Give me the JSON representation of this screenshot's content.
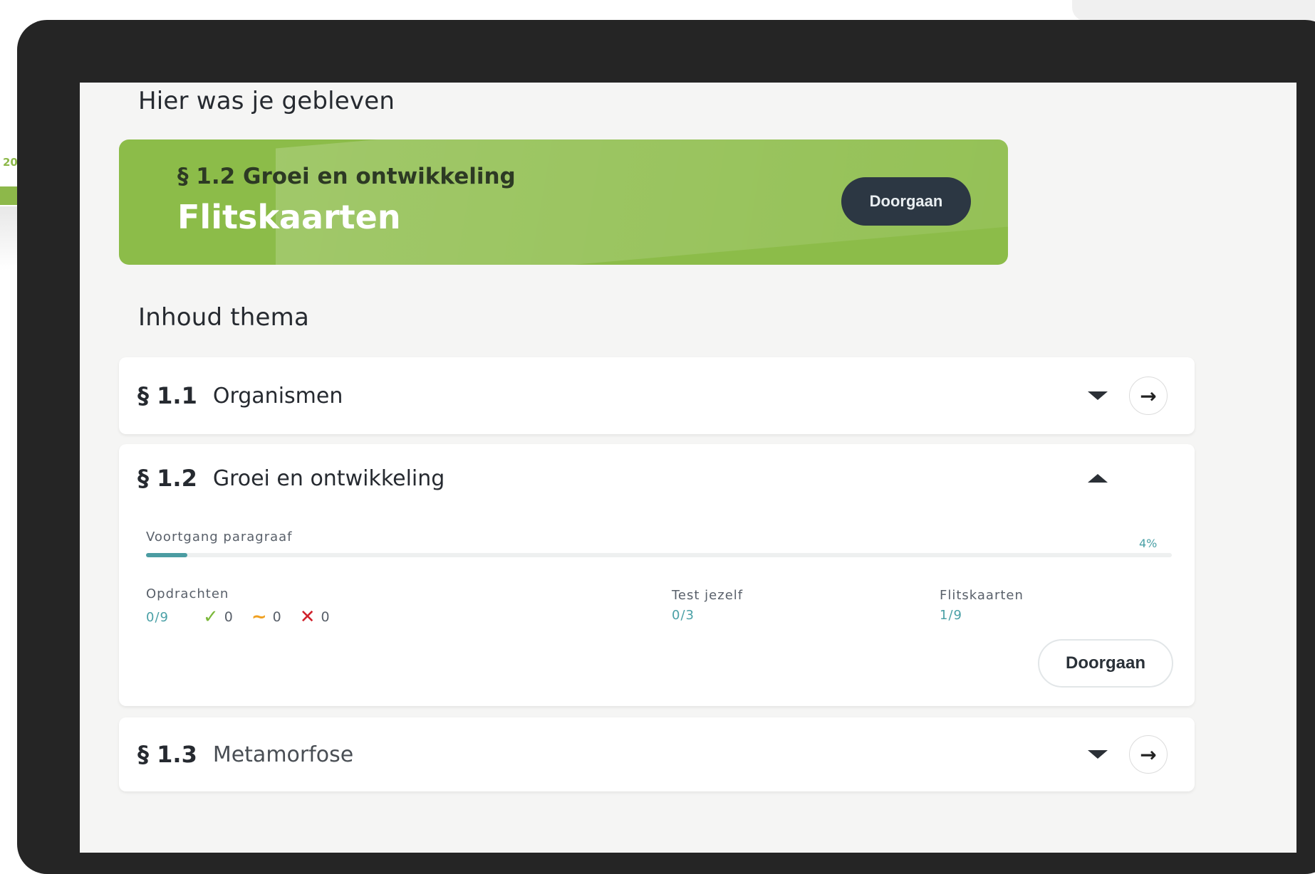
{
  "resume": {
    "heading": "Hier was je gebleven",
    "paragraph": "§ 1.2 Groei en ontwikkeling",
    "activity": "Flitskaarten",
    "button_label": "Doorgaan"
  },
  "contents": {
    "heading": "Inhoud thema",
    "sections": [
      {
        "num": "§ 1.1",
        "title": "Organismen"
      },
      {
        "num": "§ 1.2",
        "title": "Groei en ontwikkeling",
        "progress_label": "Voortgang paragraaf",
        "progress_value": "4%",
        "progress_fraction": 0.04,
        "opdrachten": {
          "label": "Opdrachten",
          "value": "0/9",
          "correct": "0",
          "partial": "0",
          "wrong": "0"
        },
        "test": {
          "label": "Test jezelf",
          "value": "0/3"
        },
        "flitskaarten": {
          "label": "Flitskaarten",
          "value": "1/9"
        },
        "button_label": "Doorgaan"
      },
      {
        "num": "§ 1.3",
        "title": "Metamorfose"
      }
    ]
  },
  "colors": {
    "accent_green": "#8cbc49",
    "progress_teal": "#4b9ca2",
    "correct": "#7bb83a",
    "partial": "#f0a020",
    "wrong": "#d0202a"
  }
}
